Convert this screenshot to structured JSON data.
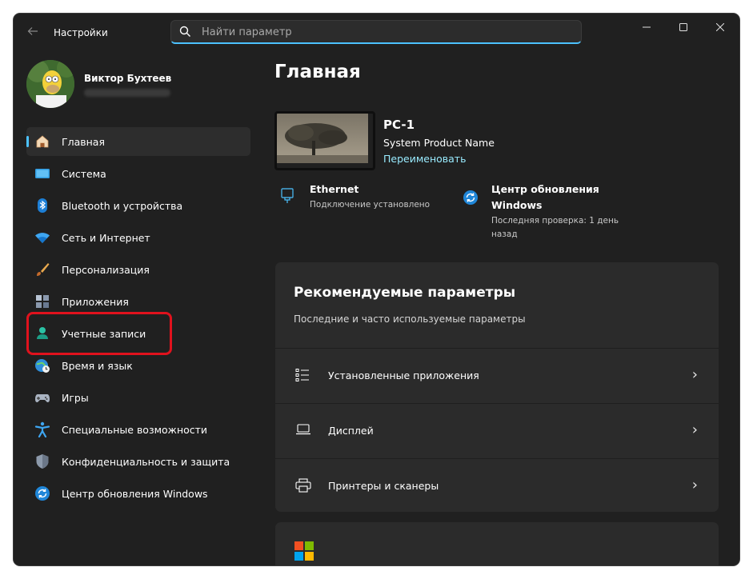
{
  "titlebar": {
    "app_title": "Настройки",
    "search_placeholder": "Найти параметр"
  },
  "profile": {
    "name": "Виктор Бухтеев",
    "email": ""
  },
  "nav": {
    "items": [
      {
        "label": "Главная",
        "icon": "home-icon",
        "active": true
      },
      {
        "label": "Система",
        "icon": "system-icon"
      },
      {
        "label": "Bluetooth и устройства",
        "icon": "bluetooth-icon"
      },
      {
        "label": "Сеть и Интернет",
        "icon": "wifi-icon"
      },
      {
        "label": "Персонализация",
        "icon": "brush-icon"
      },
      {
        "label": "Приложения",
        "icon": "apps-icon"
      },
      {
        "label": "Учетные записи",
        "icon": "person-icon"
      },
      {
        "label": "Время и язык",
        "icon": "globe-clock-icon"
      },
      {
        "label": "Игры",
        "icon": "gamepad-icon"
      },
      {
        "label": "Специальные возможности",
        "icon": "accessibility-icon"
      },
      {
        "label": "Конфиденциальность и защита",
        "icon": "shield-icon"
      },
      {
        "label": "Центр обновления Windows",
        "icon": "update-icon"
      }
    ]
  },
  "main": {
    "title": "Главная",
    "pc": {
      "name": "PC-1",
      "model": "System Product Name",
      "rename": "Переименовать"
    },
    "ethernet": {
      "title": "Ethernet",
      "status": "Подключение установлено"
    },
    "update": {
      "title_line1": "Центр обновления",
      "title_line2": "Windows",
      "status_line1": "Последняя проверка: 1 день",
      "status_line2": "назад"
    },
    "recommended": {
      "title": "Рекомендуемые параметры",
      "subtitle": "Последние и часто используемые параметры",
      "rows": [
        {
          "label": "Установленные приложения",
          "icon": "apps-list-icon"
        },
        {
          "label": "Дисплей",
          "icon": "laptop-icon"
        },
        {
          "label": "Принтеры и сканеры",
          "icon": "printer-icon"
        }
      ]
    }
  },
  "colors": {
    "accent": "#4cc2ff",
    "highlight": "#e0121d",
    "background": "#202020",
    "card": "#2b2b2b"
  }
}
